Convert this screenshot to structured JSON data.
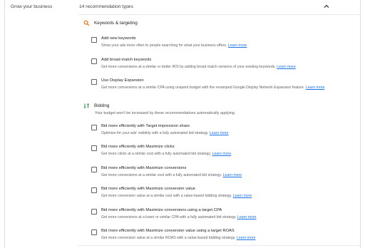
{
  "section": {
    "label": "Grow your business",
    "count": "14 recommendation types",
    "collapse_icon": "chevron-up-icon"
  },
  "groups": [
    {
      "title": "Keywords & targeting",
      "icon": "search-icon",
      "icon_color": "#e8710a",
      "items": [
        {
          "title": "Add new keywords",
          "desc": "Show your ads more often to people searching for what your business offers.",
          "link": "Learn more"
        },
        {
          "title": "Add broad match keywords",
          "desc": "Get more conversions at a similar or better ROI by adding broad match versions of your existing keywords.",
          "link": "Learn more"
        },
        {
          "title": "Use Display Expansion",
          "desc": "Get more conversions at a similar CPA using unspent budget with the revamped Google Display Network Expansion feature.",
          "link": "Learn more"
        }
      ]
    },
    {
      "title": "Bidding",
      "icon": "bidding-icon",
      "icon_color": "#1e8e3e",
      "note": "Your budget won't be increased by these recommendations automatically applying",
      "items": [
        {
          "title": "Bid more efficiently with Target impression share",
          "desc": "Optimize for your ads' visibility with a fully automated bid strategy.",
          "link": "Learn more"
        },
        {
          "title": "Bid more efficiently with Maximize clicks",
          "desc": "Get more clicks at a similar cost with a fully automated bid strategy.",
          "link": "Learn more"
        },
        {
          "title": "Bid more efficiently with Maximize conversions",
          "desc": "Get more conversions at a similar cost with a fully automated bid strategy.",
          "link": "Learn more"
        },
        {
          "title": "Bid more efficiently with Maximize conversion value",
          "desc": "Get more conversion value at a similar cost with a value-based bidding strategy.",
          "link": "Learn more"
        },
        {
          "title": "Bid more efficiently with Maximize conversions using a target CPA",
          "desc": "Get more conversions at a lower or similar CPA with a fully automated bid strategy.",
          "link": "Learn more"
        },
        {
          "title": "Bid more efficiently with Maximize conversion value using a target ROAS",
          "desc": "Get more conversion value at a similar ROAS with a value-based bidding strategy.",
          "link": "Learn more"
        }
      ]
    }
  ]
}
